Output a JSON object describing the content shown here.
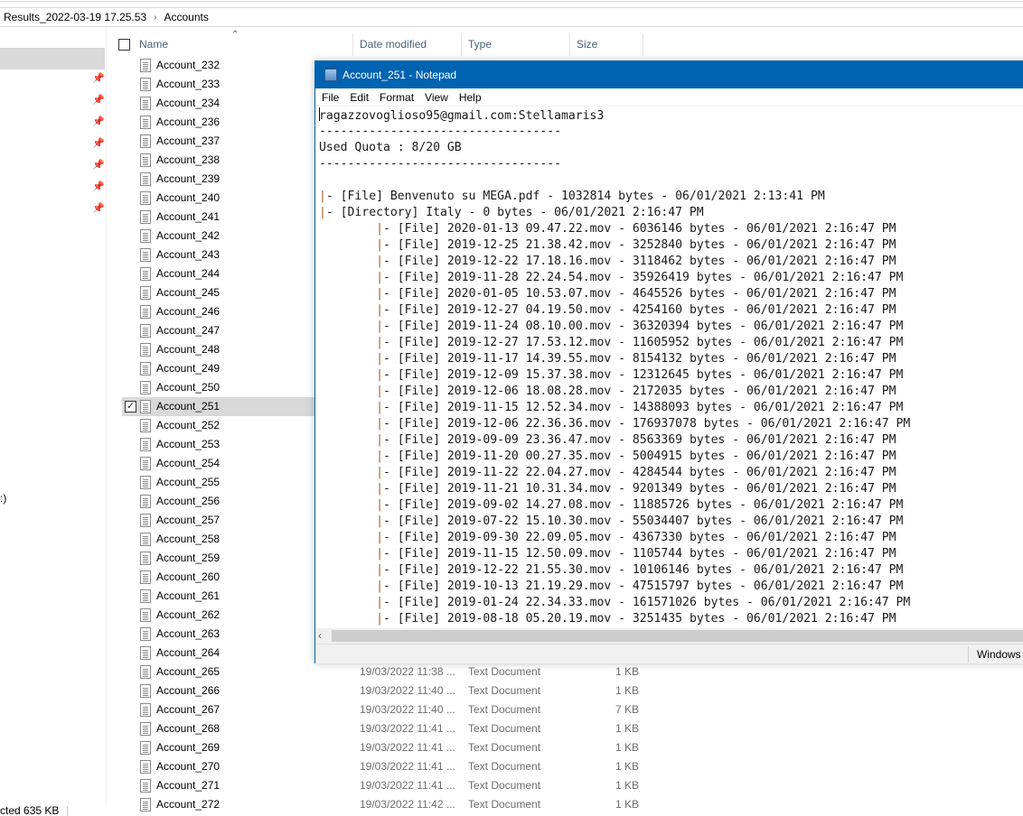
{
  "explorer": {
    "breadcrumb": [
      "Results_2022-03-19 17.25.53",
      "Accounts"
    ],
    "nav_drive_label": ":)",
    "columns": {
      "name": "Name",
      "date": "Date modified",
      "type": "Type",
      "size": "Size"
    },
    "files": [
      {
        "name": "Account_232"
      },
      {
        "name": "Account_233"
      },
      {
        "name": "Account_234"
      },
      {
        "name": "Account_236"
      },
      {
        "name": "Account_237"
      },
      {
        "name": "Account_238"
      },
      {
        "name": "Account_239"
      },
      {
        "name": "Account_240"
      },
      {
        "name": "Account_241"
      },
      {
        "name": "Account_242"
      },
      {
        "name": "Account_243"
      },
      {
        "name": "Account_244"
      },
      {
        "name": "Account_245"
      },
      {
        "name": "Account_246"
      },
      {
        "name": "Account_247"
      },
      {
        "name": "Account_248"
      },
      {
        "name": "Account_249"
      },
      {
        "name": "Account_250"
      },
      {
        "name": "Account_251",
        "selected": true
      },
      {
        "name": "Account_252"
      },
      {
        "name": "Account_253"
      },
      {
        "name": "Account_254"
      },
      {
        "name": "Account_255"
      },
      {
        "name": "Account_256"
      },
      {
        "name": "Account_257"
      },
      {
        "name": "Account_258"
      },
      {
        "name": "Account_259"
      },
      {
        "name": "Account_260"
      },
      {
        "name": "Account_261"
      },
      {
        "name": "Account_262"
      },
      {
        "name": "Account_263"
      },
      {
        "name": "Account_264"
      },
      {
        "name": "Account_265",
        "date": "19/03/2022 11:38 ...",
        "type": "Text Document",
        "size": "1 KB"
      },
      {
        "name": "Account_266",
        "date": "19/03/2022 11:40 ...",
        "type": "Text Document",
        "size": "1 KB"
      },
      {
        "name": "Account_267",
        "date": "19/03/2022 11:40 ...",
        "type": "Text Document",
        "size": "7 KB"
      },
      {
        "name": "Account_268",
        "date": "19/03/2022 11:41 ...",
        "type": "Text Document",
        "size": "1 KB"
      },
      {
        "name": "Account_269",
        "date": "19/03/2022 11:41 ...",
        "type": "Text Document",
        "size": "1 KB"
      },
      {
        "name": "Account_270",
        "date": "19/03/2022 11:41 ...",
        "type": "Text Document",
        "size": "1 KB"
      },
      {
        "name": "Account_271",
        "date": "19/03/2022 11:41 ...",
        "type": "Text Document",
        "size": "1 KB"
      },
      {
        "name": "Account_272",
        "date": "19/03/2022 11:42 ...",
        "type": "Text Document",
        "size": "1 KB"
      }
    ],
    "status_text": "cted  635 KB"
  },
  "notepad": {
    "title": "Account_251 - Notepad",
    "menu": [
      "File",
      "Edit",
      "Format",
      "View",
      "Help"
    ],
    "encoding": "Windows",
    "lines": [
      "ragazzovoglioso95@gmail.com:Stellamaris3",
      "----------------------------------",
      "Used Quota : 8/20 GB",
      "----------------------------------",
      "",
      "|- [File] Benvenuto su MEGA.pdf - 1032814 bytes - 06/01/2021 2:13:41 PM",
      "|- [Directory] Italy - 0 bytes - 06/01/2021 2:16:47 PM",
      "        |- [File] 2020-01-13 09.47.22.mov - 6036146 bytes - 06/01/2021 2:16:47 PM",
      "        |- [File] 2019-12-25 21.38.42.mov - 3252840 bytes - 06/01/2021 2:16:47 PM",
      "        |- [File] 2019-12-22 17.18.16.mov - 3118462 bytes - 06/01/2021 2:16:47 PM",
      "        |- [File] 2019-11-28 22.24.54.mov - 35926419 bytes - 06/01/2021 2:16:47 PM",
      "        |- [File] 2020-01-05 10.53.07.mov - 4645526 bytes - 06/01/2021 2:16:47 PM",
      "        |- [File] 2019-12-27 04.19.50.mov - 4254160 bytes - 06/01/2021 2:16:47 PM",
      "        |- [File] 2019-11-24 08.10.00.mov - 36320394 bytes - 06/01/2021 2:16:47 PM",
      "        |- [File] 2019-12-27 17.53.12.mov - 11605952 bytes - 06/01/2021 2:16:47 PM",
      "        |- [File] 2019-11-17 14.39.55.mov - 8154132 bytes - 06/01/2021 2:16:47 PM",
      "        |- [File] 2019-12-09 15.37.38.mov - 12312645 bytes - 06/01/2021 2:16:47 PM",
      "        |- [File] 2019-12-06 18.08.28.mov - 2172035 bytes - 06/01/2021 2:16:47 PM",
      "        |- [File] 2019-11-15 12.52.34.mov - 14388093 bytes - 06/01/2021 2:16:47 PM",
      "        |- [File] 2019-12-06 22.36.36.mov - 176937078 bytes - 06/01/2021 2:16:47 PM",
      "        |- [File] 2019-09-09 23.36.47.mov - 8563369 bytes - 06/01/2021 2:16:47 PM",
      "        |- [File] 2019-11-20 00.27.35.mov - 5004915 bytes - 06/01/2021 2:16:47 PM",
      "        |- [File] 2019-11-22 22.04.27.mov - 4284544 bytes - 06/01/2021 2:16:47 PM",
      "        |- [File] 2019-11-21 10.31.34.mov - 9201349 bytes - 06/01/2021 2:16:47 PM",
      "        |- [File] 2019-09-02 14.27.08.mov - 11885726 bytes - 06/01/2021 2:16:47 PM",
      "        |- [File] 2019-07-22 15.10.30.mov - 55034407 bytes - 06/01/2021 2:16:47 PM",
      "        |- [File] 2019-09-30 22.09.05.mov - 4367330 bytes - 06/01/2021 2:16:47 PM",
      "        |- [File] 2019-11-15 12.50.09.mov - 1105744 bytes - 06/01/2021 2:16:47 PM",
      "        |- [File] 2019-12-22 21.55.30.mov - 10106146 bytes - 06/01/2021 2:16:47 PM",
      "        |- [File] 2019-10-13 21.19.29.mov - 47515797 bytes - 06/01/2021 2:16:47 PM",
      "        |- [File] 2019-01-24 22.34.33.mov - 161571026 bytes - 06/01/2021 2:16:47 PM",
      "        |- [File] 2019-08-18 05.20.19.mov - 3251435 bytes - 06/01/2021 2:16:47 PM"
    ]
  }
}
